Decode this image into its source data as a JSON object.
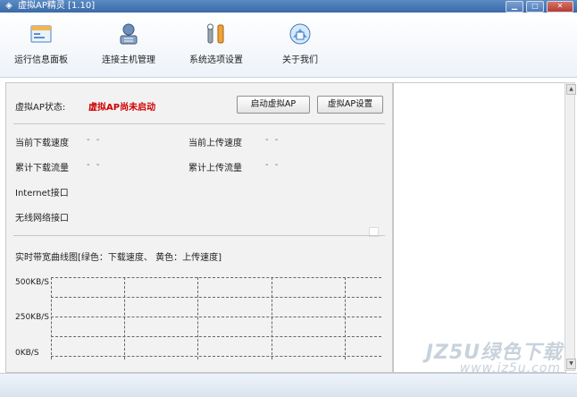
{
  "window": {
    "title": "虚拟AP精灵 [1.10]",
    "buttons": {
      "minimize": "▁",
      "maximize": "□",
      "close": "✕"
    }
  },
  "toolbar": {
    "items": [
      {
        "label": "运行信息面板",
        "icon": "dashboard-icon"
      },
      {
        "label": "连接主机管理",
        "icon": "hosts-icon"
      },
      {
        "label": "系统选项设置",
        "icon": "settings-icon"
      },
      {
        "label": "关于我们",
        "icon": "about-icon"
      }
    ]
  },
  "panel": {
    "ap_status_label": "虚拟AP状态:",
    "ap_status_value": "虚拟AP尚未启动",
    "start_button": "启动虚拟AP",
    "settings_button": "虚拟AP设置",
    "download_speed_label": "当前下载速度",
    "download_speed_value": "- -",
    "upload_speed_label": "当前上传速度",
    "upload_speed_value": "- -",
    "total_download_label": "累计下载流量",
    "total_download_value": "- -",
    "total_upload_label": "累计上传流量",
    "total_upload_value": "- -",
    "internet_iface_label": "Internet接口",
    "wireless_iface_label": "无线网络接口",
    "graph_title": "实时带宽曲线图[绿色：下载速度、 黄色：上传速度]",
    "y_labels": [
      "500KB/S",
      "250KB/S",
      "0KB/S"
    ]
  },
  "watermark": {
    "line1": "JZ5U绿色下载",
    "line2": "www.jz5u.com"
  },
  "colors": {
    "title_bar": "#3a6aa8",
    "status_red": "#d00000",
    "dash_value": "#4b6fb5"
  }
}
